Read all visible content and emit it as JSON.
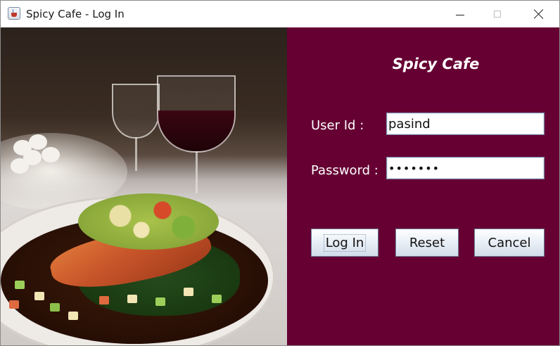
{
  "window": {
    "title": "Spicy Cafe - Log In",
    "app_icon": "java-cup-icon",
    "controls": [
      "minimize-icon",
      "maximize-icon",
      "close-icon"
    ]
  },
  "photo": {
    "subject": "plated salmon dish with wine glasses"
  },
  "login": {
    "brand": "Spicy Cafe",
    "user_label": "User Id :",
    "user_value": "pasind",
    "password_label": "Password :",
    "password_value": "•••••••",
    "login_button": "Log In",
    "reset_button": "Reset",
    "cancel_button": "Cancel"
  },
  "colors": {
    "panel_background": "#660033",
    "panel_text": "#ffffff"
  }
}
